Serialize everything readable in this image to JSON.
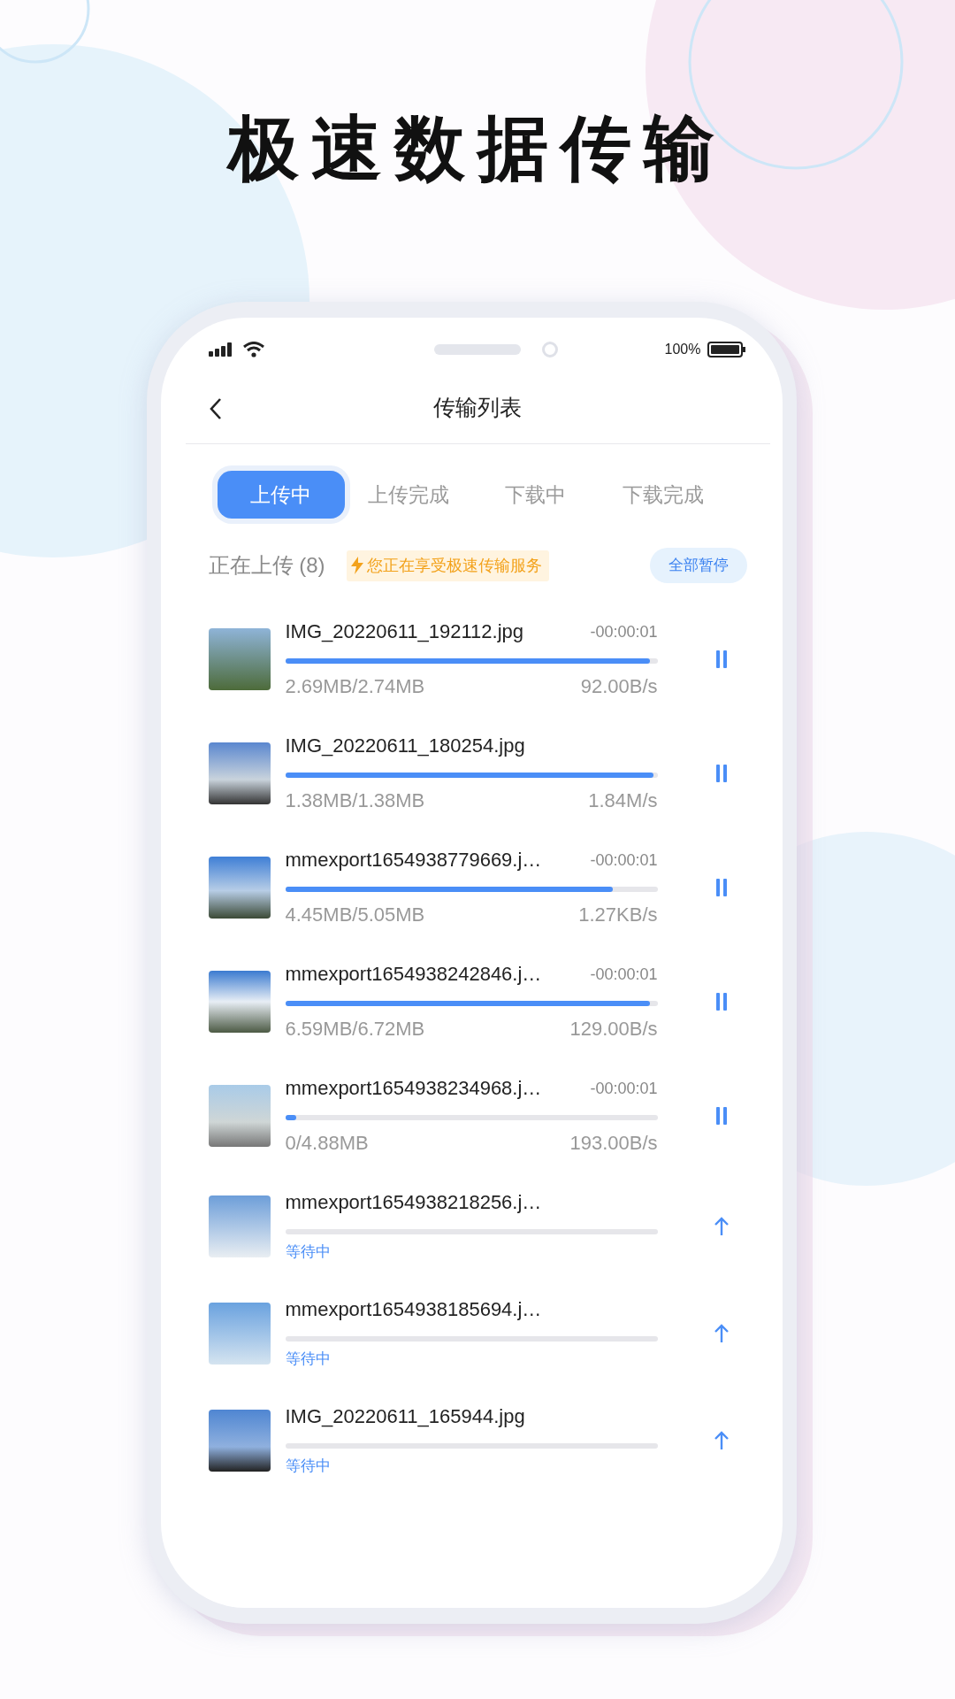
{
  "headline": "极速数据传输",
  "status_bar": {
    "battery_text": "100%"
  },
  "header": {
    "title": "传输列表"
  },
  "tabs": [
    {
      "label": "上传中",
      "selected": true
    },
    {
      "label": "上传完成",
      "selected": false
    },
    {
      "label": "下载中",
      "selected": false
    },
    {
      "label": "下载完成",
      "selected": false
    }
  ],
  "section": {
    "title": "正在上传 (8)",
    "promo": "您正在享受极速传输服务",
    "pause_all": "全部暂停"
  },
  "transfers": [
    {
      "kind": "uploading",
      "name": "IMG_20220611_192112.jpg",
      "remaining": "-00:00:01",
      "level": 0.98,
      "size": "2.69MB/2.74MB",
      "speed": "92.00B/s"
    },
    {
      "kind": "uploading",
      "name": "IMG_20220611_180254.jpg",
      "level": 0.99,
      "size": "1.38MB/1.38MB",
      "speed": "1.84M/s"
    },
    {
      "kind": "uploading",
      "name": "mmexport1654938779669.j…",
      "remaining": "-00:00:01",
      "level": 0.88,
      "size": "4.45MB/5.05MB",
      "speed": "1.27KB/s"
    },
    {
      "kind": "uploading",
      "name": "mmexport1654938242846.j…",
      "remaining": "-00:00:01",
      "level": 0.98,
      "size": "6.59MB/6.72MB",
      "speed": "129.00B/s"
    },
    {
      "kind": "uploading",
      "name": "mmexport1654938234968.j…",
      "remaining": "-00:00:01",
      "level": 0.03,
      "size": "0/4.88MB",
      "speed": "193.00B/s"
    },
    {
      "kind": "waiting",
      "name": "mmexport1654938218256.j…",
      "level": 0,
      "status": "等待中"
    },
    {
      "kind": "waiting",
      "name": "mmexport1654938185694.j…",
      "level": 0,
      "status": "等待中"
    },
    {
      "kind": "waiting",
      "name": "IMG_20220611_165944.jpg",
      "level": 0,
      "status": "等待中"
    }
  ]
}
